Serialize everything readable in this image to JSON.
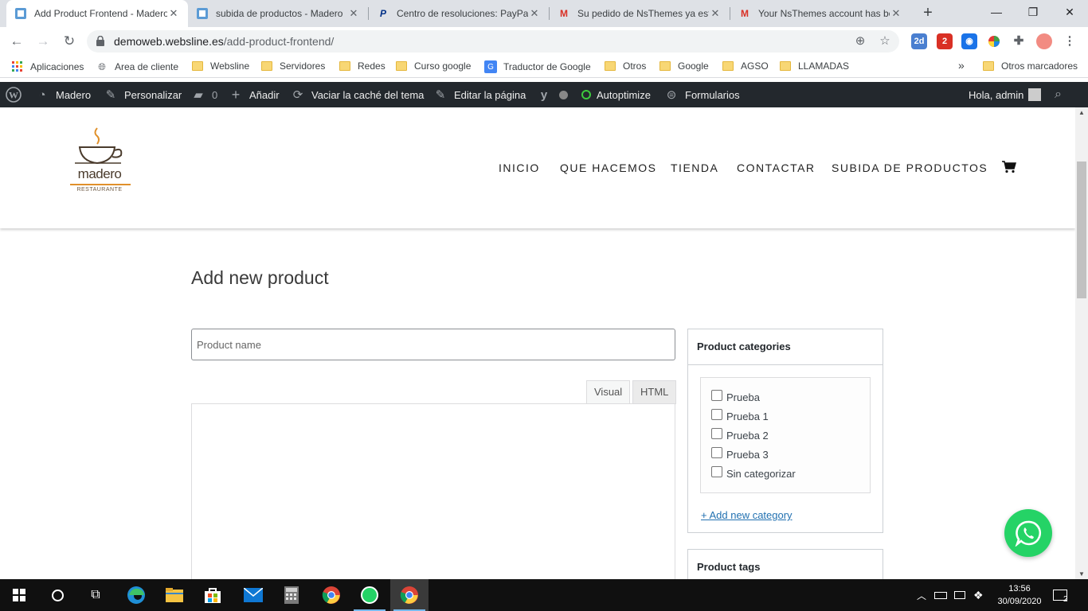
{
  "browser": {
    "tabs": [
      {
        "title": "Add Product Frontend - Madero",
        "active": true,
        "favicon": "madero-favicon-icon"
      },
      {
        "title": "subida de productos - Madero",
        "active": false,
        "favicon": "madero-favicon-icon"
      },
      {
        "title": "Centro de resoluciones: PayPal",
        "active": false,
        "favicon": "paypal-icon"
      },
      {
        "title": "Su pedido de NsThemes ya está",
        "active": false,
        "favicon": "gmail-icon"
      },
      {
        "title": "Your NsThemes account has be",
        "active": false,
        "favicon": "gmail-icon"
      }
    ],
    "url_host": "demoweb.websline.es",
    "url_path": "/add-product-frontend/",
    "extension_badges": {
      "calendar": "2d",
      "mail": "2"
    },
    "bookmarks": [
      {
        "label": "Aplicaciones",
        "icon": "apps-grid-icon"
      },
      {
        "label": "Area de cliente",
        "icon": "globe-icon"
      },
      {
        "label": "Websline",
        "icon": "folder-icon"
      },
      {
        "label": "Servidores",
        "icon": "folder-icon"
      },
      {
        "label": "Redes",
        "icon": "folder-icon"
      },
      {
        "label": "Curso google",
        "icon": "folder-icon"
      },
      {
        "label": "Traductor de Google",
        "icon": "google-translate-icon"
      },
      {
        "label": "Otros",
        "icon": "folder-icon"
      },
      {
        "label": "Google",
        "icon": "folder-icon"
      },
      {
        "label": "AGSO",
        "icon": "folder-icon"
      },
      {
        "label": "LLAMADAS",
        "icon": "folder-icon"
      }
    ],
    "bookmarks_overflow": "»",
    "other_bookmarks": "Otros marcadores"
  },
  "adminbar": {
    "site": "Madero",
    "customize": "Personalizar",
    "comments": "0",
    "new": "Añadir",
    "clear_cache": "Vaciar la caché del tema",
    "edit_page": "Editar la página",
    "autoptimize": "Autoptimize",
    "forms": "Formularios",
    "greeting": "Hola, admin"
  },
  "site": {
    "logo_word": "madero",
    "logo_sub": "RESTAURANTE",
    "menu": [
      "INICIO",
      "QUE HACEMOS",
      "TIENDA",
      "CONTACTAR",
      "SUBIDA DE PRODUCTOS"
    ]
  },
  "form": {
    "title": "Add new product",
    "product_name_placeholder": "Product name",
    "editor_tabs": [
      "Visual",
      "HTML"
    ],
    "categories_title": "Product categories",
    "categories": [
      "Prueba",
      "Prueba 1",
      "Prueba 2",
      "Prueba 3",
      "Sin categorizar"
    ],
    "add_category": "+ Add new category",
    "tags_title": "Product tags"
  },
  "taskbar": {
    "time": "13:56",
    "date": "30/09/2020",
    "notifications": "2"
  },
  "colors": {
    "adminbar": "#23282d",
    "whatsapp": "#25d366",
    "link": "#2271b1"
  }
}
